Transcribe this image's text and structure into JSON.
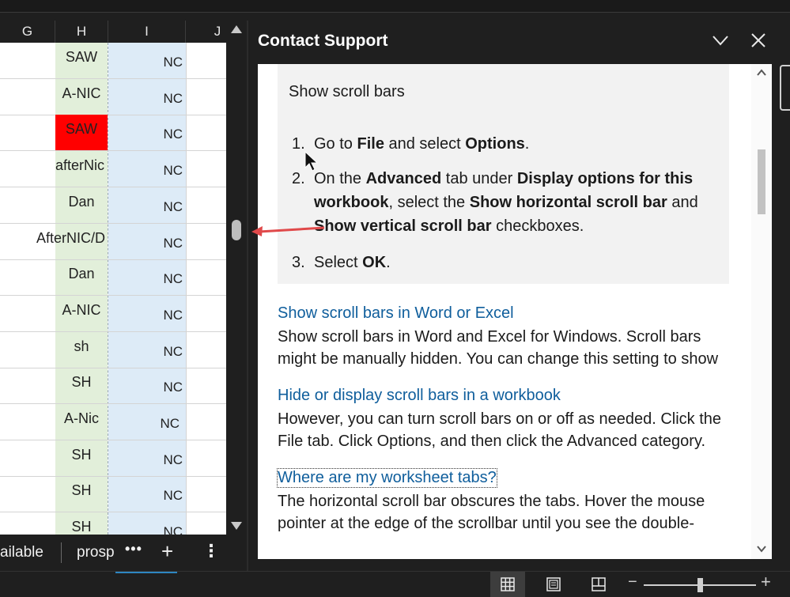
{
  "spreadsheet": {
    "columns": [
      "G",
      "H",
      "I",
      "J"
    ],
    "rows": [
      {
        "h": "SAW",
        "i": "NC",
        "h_highlight": false
      },
      {
        "h": "A-NIC",
        "i": "NC",
        "h_highlight": false
      },
      {
        "h": "SAW",
        "i": "NC",
        "h_highlight": true
      },
      {
        "h": "afterNic",
        "i": "NC",
        "h_highlight": false
      },
      {
        "h": "Dan",
        "i": "NC",
        "h_highlight": false
      },
      {
        "h": "AfterNIC/D",
        "i": "NC",
        "h_highlight": false
      },
      {
        "h": "Dan",
        "i": "NC",
        "h_highlight": false
      },
      {
        "h": "A-NIC",
        "i": "NC",
        "h_highlight": false
      },
      {
        "h": "sh",
        "i": "NC",
        "h_highlight": false
      },
      {
        "h": "SH",
        "i": "NC",
        "h_highlight": false
      },
      {
        "h": "A-Nic",
        "i": "NC",
        "h_highlight": false
      },
      {
        "h": "SH",
        "i": "NC",
        "h_highlight": false
      },
      {
        "h": "SH",
        "i": "NC",
        "h_highlight": false
      },
      {
        "h": "SH",
        "i": "NC",
        "h_highlight": false
      }
    ],
    "highlight_color": "#ff0000",
    "column_h_fill": "#e2efda",
    "column_i_fill": "#ddebf7"
  },
  "sheet_tabs": {
    "tab1": "ailable",
    "tab2": "prosp",
    "more": "•••",
    "add": "+",
    "menu": "⋮"
  },
  "support_pane": {
    "title": "Contact Support",
    "box_title": "Show scroll bars",
    "steps": [
      {
        "num": "1."
      },
      {
        "num": "2."
      },
      {
        "num": "3."
      }
    ],
    "step1": {
      "a": "Go to ",
      "b": "File",
      "c": " and select ",
      "d": "Options",
      "e": "."
    },
    "step2": {
      "a": "On the ",
      "b": "Advanced",
      "c": " tab under ",
      "d": "Display options for this workbook",
      "e": ", select the ",
      "f": "Show horizontal scroll bar",
      "g": " and ",
      "h": "Show vertical scroll bar",
      "i": " checkboxes."
    },
    "step3": {
      "a": "Select ",
      "b": "OK",
      "c": "."
    },
    "results": [
      {
        "title": "Show scroll bars in Word or Excel",
        "line1": "Show scroll bars in Word and Excel for Windows. Scroll bars",
        "line2": "might be manually hidden. You can change this setting to show"
      },
      {
        "title": "Hide or display scroll bars in a workbook",
        "line1": "However, you can turn scroll bars on or off as needed. Click the",
        "line2": "File tab. Click Options, and then click the Advanced category."
      },
      {
        "title": "Where are my worksheet tabs?",
        "line1": "The horizontal scroll bar obscures the tabs. Hover the mouse",
        "line2": "pointer at the edge of the scrollbar until you see the double-"
      }
    ],
    "link_color": "#0f5e9c"
  },
  "status_bar": {
    "zoom_minus": "−",
    "zoom_plus": "+",
    "accent_color": "#2e86c1"
  },
  "annotation": {
    "arrow_color": "#e0494a"
  }
}
